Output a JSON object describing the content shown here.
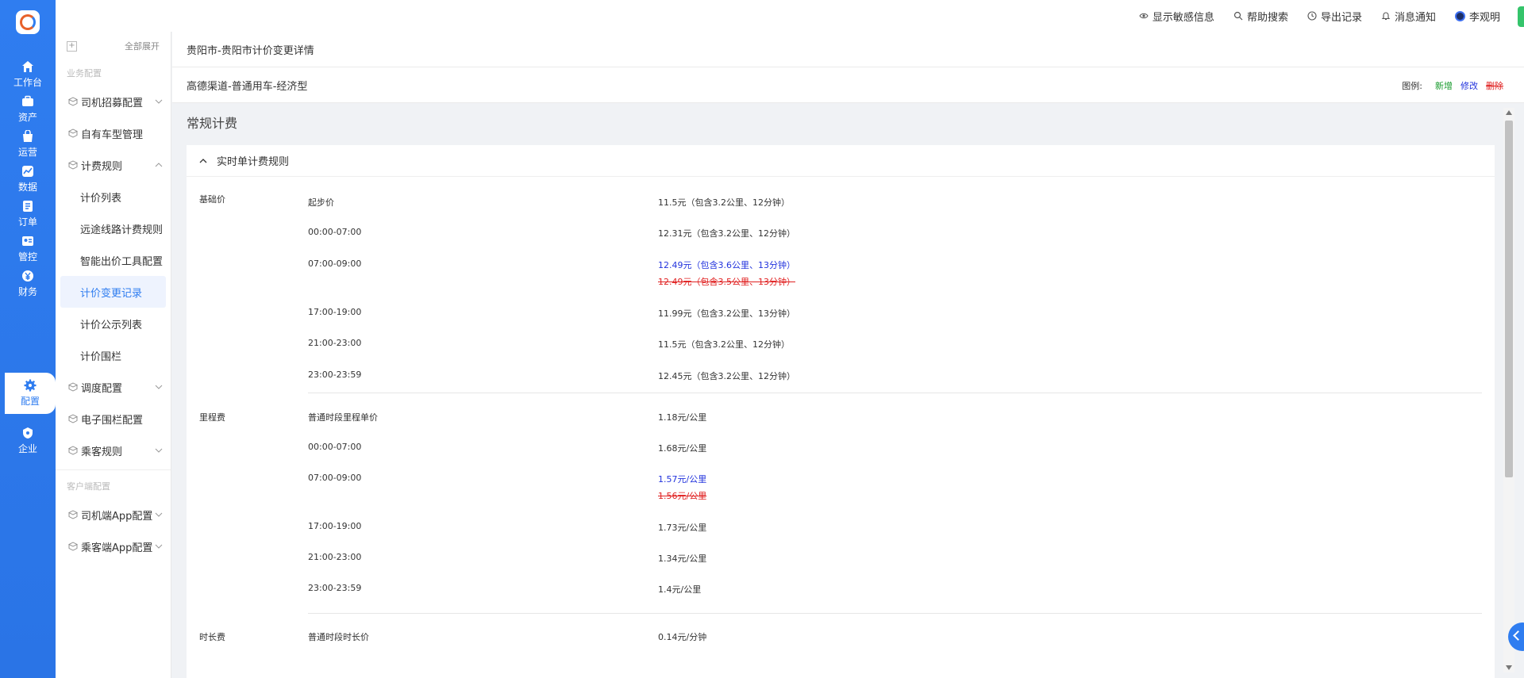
{
  "rail": {
    "items": [
      {
        "label": "工作台",
        "icon": "home-icon"
      },
      {
        "label": "资产",
        "icon": "briefcase-icon"
      },
      {
        "label": "运营",
        "icon": "bag-icon"
      },
      {
        "label": "数据",
        "icon": "chart-icon"
      },
      {
        "label": "订单",
        "icon": "document-icon"
      },
      {
        "label": "管控",
        "icon": "id-card-icon"
      },
      {
        "label": "财务",
        "icon": "yen-icon"
      },
      {
        "label": "配置",
        "icon": "gear-icon"
      },
      {
        "label": "企业",
        "icon": "shield-icon"
      }
    ],
    "active": "配置"
  },
  "topbar": {
    "show_sensitive": "显示敏感信息",
    "help_search": "帮助搜索",
    "export_records": "导出记录",
    "notifications": "消息通知",
    "user_name": "李观明"
  },
  "sidebar": {
    "expand_all": "全部展开",
    "group_business": "业务配置",
    "driver_recruit": "司机招募配置",
    "own_vehicle": "自有车型管理",
    "pricing_rules": "计费规则",
    "sub_price_list": "计价列表",
    "sub_long_route": "远途线路计费规则",
    "sub_smart_tool": "智能出价工具配置",
    "sub_change_log": "计价变更记录",
    "sub_public_list": "计价公示列表",
    "sub_fence": "计价围栏",
    "dispatch": "调度配置",
    "geofence": "电子围栏配置",
    "passenger_rules": "乘客规则",
    "group_client": "客户端配置",
    "driver_app": "司机端App配置",
    "passenger_app": "乘客端App配置"
  },
  "main": {
    "title": "贵阳市-贵阳市计价变更详情",
    "subtitle": "高德渠道-普通用车-经济型",
    "legend": {
      "label": "图例:",
      "add": "新增",
      "modify": "修改",
      "delete": "删除"
    },
    "section_title": "常规计费",
    "card_title": "实时单计费规则",
    "base_price": {
      "category": "基础价",
      "rows": [
        {
          "name": "起步价",
          "value": "11.5元（包含3.2公里、12分钟）"
        },
        {
          "name": "00:00-07:00",
          "value": "12.31元（包含3.2公里、12分钟）"
        },
        {
          "name": "07:00-09:00",
          "value": "12.49元（包含3.6公里、13分钟）",
          "old": "12.49元（包含3.5公里、13分钟）"
        },
        {
          "name": "17:00-19:00",
          "value": "11.99元（包含3.2公里、13分钟）"
        },
        {
          "name": "21:00-23:00",
          "value": "11.5元（包含3.2公里、12分钟）"
        },
        {
          "name": "23:00-23:59",
          "value": "12.45元（包含3.2公里、12分钟）"
        }
      ]
    },
    "mileage": {
      "category": "里程费",
      "rows": [
        {
          "name": "普通时段里程单价",
          "value": "1.18元/公里"
        },
        {
          "name": "00:00-07:00",
          "value": "1.68元/公里"
        },
        {
          "name": "07:00-09:00",
          "value": "1.57元/公里",
          "old": "1.56元/公里"
        },
        {
          "name": "17:00-19:00",
          "value": "1.73元/公里"
        },
        {
          "name": "21:00-23:00",
          "value": "1.34元/公里"
        },
        {
          "name": "23:00-23:59",
          "value": "1.4元/公里"
        }
      ]
    },
    "duration": {
      "category": "时长费",
      "rows": [
        {
          "name": "普通时段时长价",
          "value": "0.14元/分钟"
        }
      ]
    }
  },
  "colors": {
    "accent": "#2f7df0",
    "add": "#1a9b2e",
    "modify": "#2233dd",
    "delete": "#e02020"
  }
}
